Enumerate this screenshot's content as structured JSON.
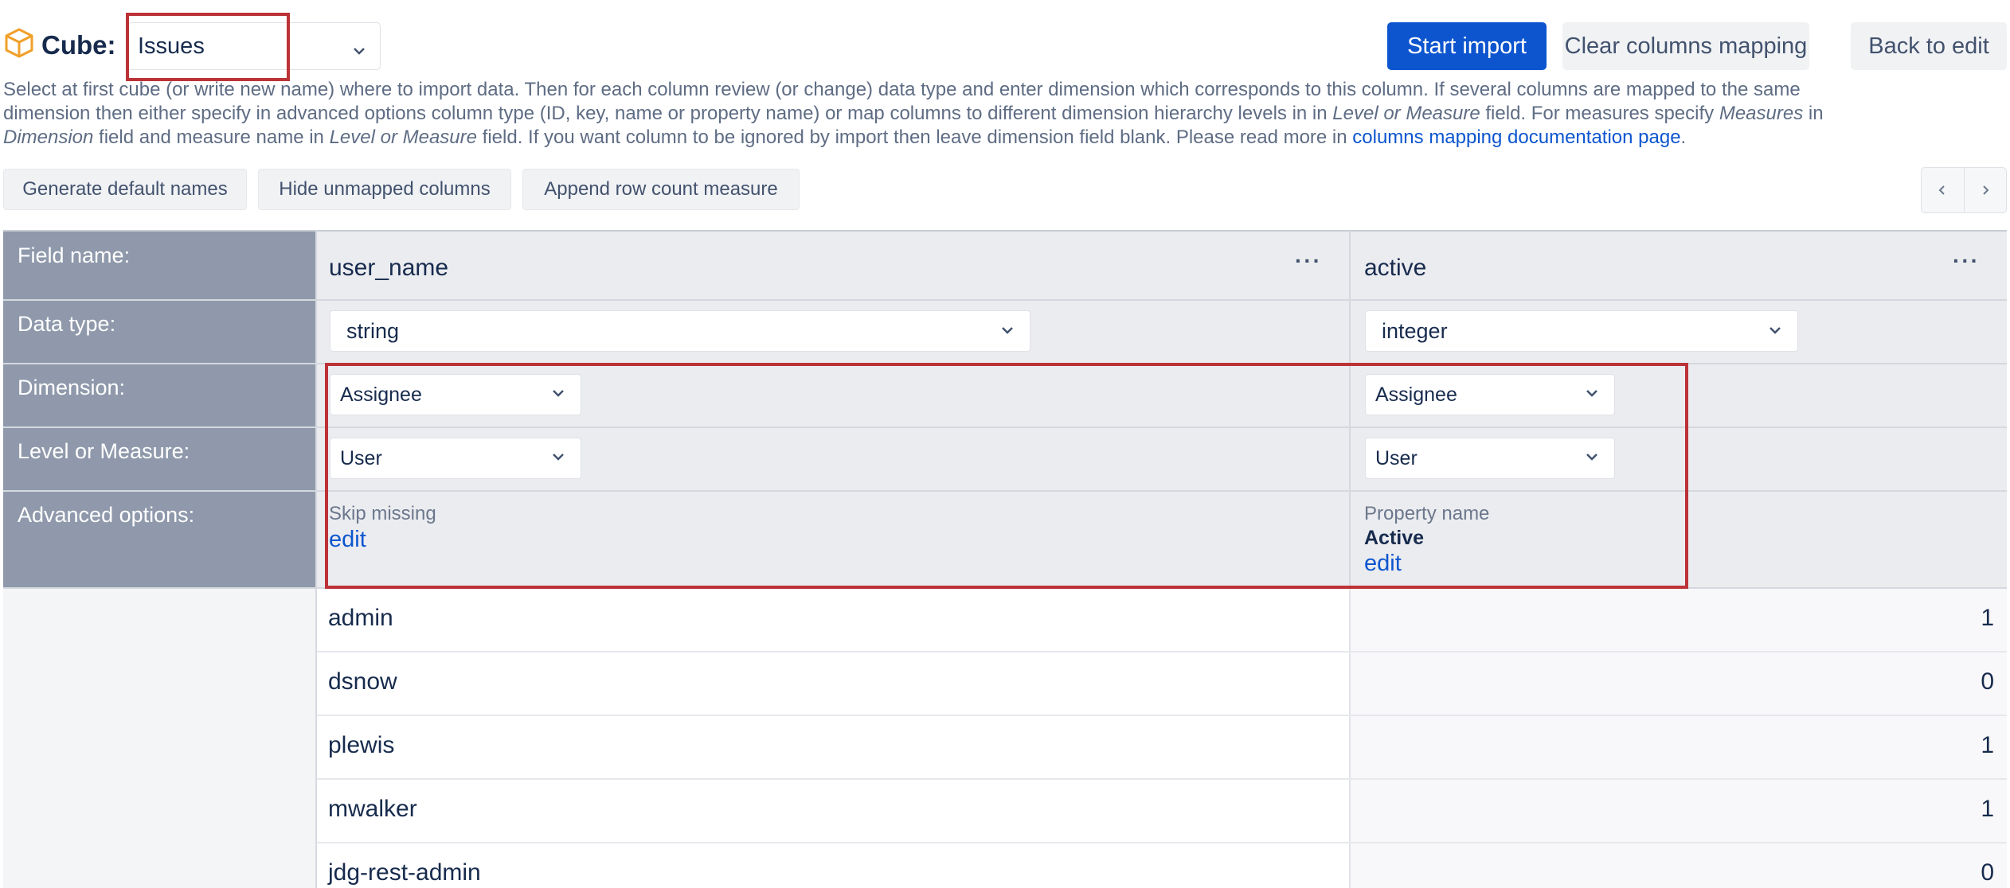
{
  "cube": {
    "label": "Cube:",
    "selected": "Issues",
    "icon": "cube-icon"
  },
  "actions": {
    "start_import": "Start import",
    "clear_mapping": "Clear columns mapping",
    "back_to_edit": "Back to edit"
  },
  "description": {
    "line1": "Select at first cube (or write new name) where to import data. Then for each column review (or change) data type and enter dimension which corresponds to this column. If several columns are mapped to the same",
    "line2a": "dimension then either specify in advanced options column type (ID, key, name or property name) or map columns to different dimension hierarchy levels in in ",
    "line2b": "Level or Measure",
    "line2c": " field. For measures specify ",
    "line2d": "Measures",
    "line2e": " in",
    "line3a": "Dimension",
    "line3b": " field and measure name in ",
    "line3c": "Level or Measure",
    "line3d": " field. If you want column to be ignored by import then leave dimension field blank. Please read more in ",
    "link": "columns mapping documentation page",
    "line3e": "."
  },
  "toolbar": {
    "generate": "Generate default names",
    "hide_unmapped": "Hide unmapped columns",
    "append_row_count": "Append row count measure"
  },
  "row_labels": {
    "field_name": "Field name:",
    "data_type": "Data type:",
    "dimension": "Dimension:",
    "level": "Level or Measure:",
    "advanced": "Advanced options:"
  },
  "columns": [
    {
      "field_name": "user_name",
      "menu": "···",
      "data_type": "string",
      "dimension": "Assignee",
      "level": "User",
      "adv_label": "Skip missing",
      "adv_value": "",
      "adv_link": "edit"
    },
    {
      "field_name": "active",
      "menu": "···",
      "data_type": "integer",
      "dimension": "Assignee",
      "level": "User",
      "adv_label": "Property name",
      "adv_value": "Active",
      "adv_link": "edit"
    }
  ],
  "rows": [
    [
      "admin",
      "1"
    ],
    [
      "dsnow",
      "0"
    ],
    [
      "plewis",
      "1"
    ],
    [
      "mwalker",
      "1"
    ],
    [
      "jdg-rest-admin",
      "0"
    ]
  ],
  "colors": {
    "primary": "#0c55cf",
    "highlight": "#bb3237",
    "label_bg": "#8f99ab",
    "cube_icon": "#f0a02a"
  }
}
